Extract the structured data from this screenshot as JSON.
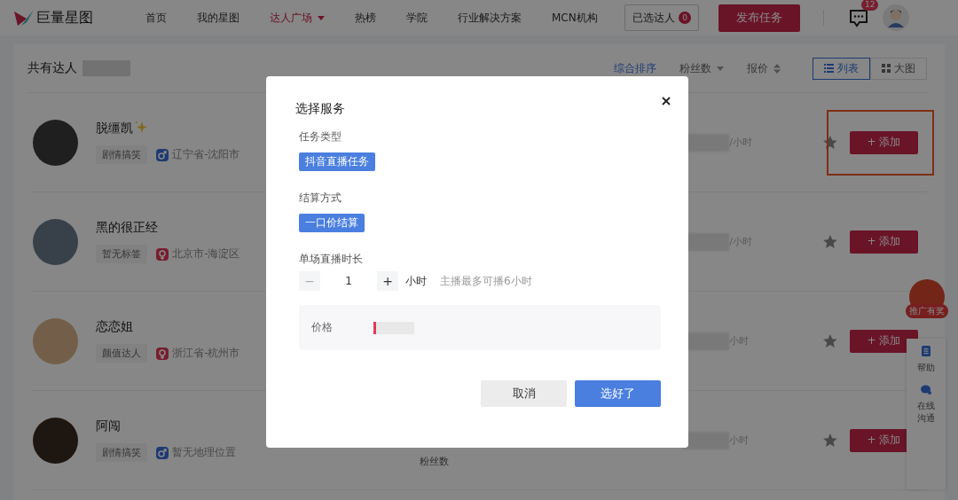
{
  "header": {
    "logo_text": "巨量星图",
    "nav": [
      {
        "label": "首页",
        "selected": false
      },
      {
        "label": "我的星图",
        "selected": false
      },
      {
        "label": "达人广场",
        "selected": true,
        "has_menu": true
      },
      {
        "label": "热榜",
        "selected": false
      },
      {
        "label": "学院",
        "selected": false
      },
      {
        "label": "行业解决方案",
        "selected": false
      },
      {
        "label": "MCN机构",
        "selected": false
      }
    ],
    "picked_button": {
      "label": "已选达人",
      "count": "0"
    },
    "publish_button": "发布任务",
    "messages_badge": "12"
  },
  "list": {
    "total_label": "共有达人",
    "sort_options": [
      {
        "label": "综合排序",
        "selected": true,
        "kind": "plain"
      },
      {
        "label": "粉丝数",
        "selected": false,
        "kind": "dropdown"
      },
      {
        "label": "报价",
        "selected": false,
        "kind": "sort"
      }
    ],
    "views": [
      {
        "label": "列表",
        "selected": true,
        "kind": "list"
      },
      {
        "label": "大图",
        "selected": false,
        "kind": "grid"
      }
    ],
    "rows": [
      {
        "name": "脱缰凯",
        "sparkle": true,
        "tag": "剧情搞笑",
        "kind": "male",
        "location": "辽宁省-沈阳市",
        "rate_suffix": "/小时",
        "add_button": "+ 添加",
        "highlighted": true
      },
      {
        "name": "黑的很正经",
        "tag": "暂无标签",
        "kind": "female",
        "location": "北京市-海淀区",
        "rate_suffix": "/小时",
        "add_button": "+ 添加"
      },
      {
        "name": "恋恋姐",
        "tag": "颜值达人",
        "kind": "female",
        "location": "浙江省-杭州市",
        "rate_suffix": "小时",
        "add_button": "+ 添加"
      },
      {
        "name": "阿闯",
        "tag": "剧情搞笑",
        "kind": "male",
        "location": "暂无地理位置",
        "rate_suffix": "小时",
        "add_button": "+ 添加",
        "stat_label": "粉丝数"
      }
    ]
  },
  "side": {
    "promo_badge": "推广有奖",
    "tools": [
      {
        "label": "帮助",
        "kind": "doc"
      },
      {
        "label": "在线沟通",
        "kind": "chat"
      }
    ]
  },
  "modal": {
    "title": "选择服务",
    "sections": [
      {
        "label": "任务类型",
        "options": [
          {
            "label": "抖音直播任务",
            "selected": true
          }
        ]
      },
      {
        "label": "结算方式",
        "options": [
          {
            "label": "一口价结算",
            "selected": true
          }
        ]
      }
    ],
    "duration": {
      "label": "单场直播时长",
      "minus": "−",
      "value": "1",
      "plus": "+",
      "unit": "小时",
      "hint": "主播最多可播6小时"
    },
    "price": {
      "label": "价格"
    },
    "buttons": [
      {
        "label": "取消",
        "kind": "secondary"
      },
      {
        "label": "选好了",
        "kind": "primary"
      }
    ]
  }
}
